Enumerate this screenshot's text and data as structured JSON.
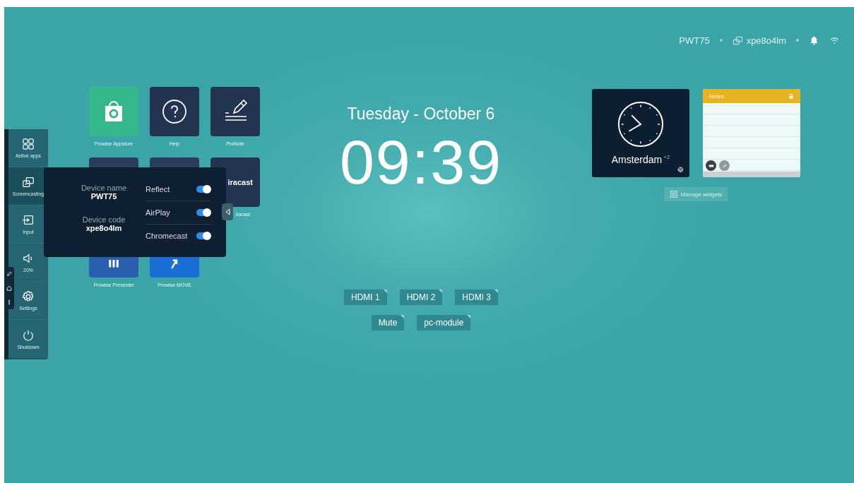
{
  "status_bar": {
    "device_name": "PWT75",
    "device_code": "xpe8o4lm"
  },
  "sidebar": {
    "items": [
      {
        "kind": "apps",
        "label": "Active apps",
        "selected": false
      },
      {
        "kind": "screencast",
        "label": "Screencasting",
        "selected": true
      },
      {
        "kind": "input",
        "label": "Input",
        "selected": false
      },
      {
        "kind": "volume",
        "label": "20%",
        "selected": false
      },
      {
        "kind": "settings",
        "label": "Settings",
        "selected": false
      },
      {
        "kind": "shutdown",
        "label": "Shutdown",
        "selected": false
      }
    ]
  },
  "apps": [
    {
      "kind": "appstore",
      "label": "Prowise Appstore"
    },
    {
      "kind": "help",
      "label": "Help"
    },
    {
      "kind": "pronote",
      "label": "ProNote"
    },
    {
      "kind": "hidden"
    },
    {
      "kind": "hidden"
    },
    {
      "kind": "miracast",
      "logo": "iracast",
      "label": "iracast"
    },
    {
      "kind": "presenter",
      "label": "Prowise Presenter"
    },
    {
      "kind": "move",
      "label": "Prowise MOVE"
    }
  ],
  "screencast_popup": {
    "device_name_label": "Device name",
    "device_name": "PWT75",
    "device_code_label": "Device code",
    "device_code": "xpe8o4lm",
    "toggles": [
      {
        "label": "Reflect",
        "on": true
      },
      {
        "label": "AirPlay",
        "on": true
      },
      {
        "label": "Chromecast",
        "on": true
      }
    ]
  },
  "date": "Tuesday - October 6",
  "time": "09:39",
  "source_rows": [
    [
      "HDMI 1",
      "HDMI 2",
      "HDMI 3"
    ],
    [
      "Mute",
      "pc-module"
    ]
  ],
  "widgets": {
    "clock": {
      "city": "Amsterdam",
      "offset": "+2"
    },
    "notes": {
      "title": "Notes"
    },
    "manage": "Manage widgets"
  }
}
